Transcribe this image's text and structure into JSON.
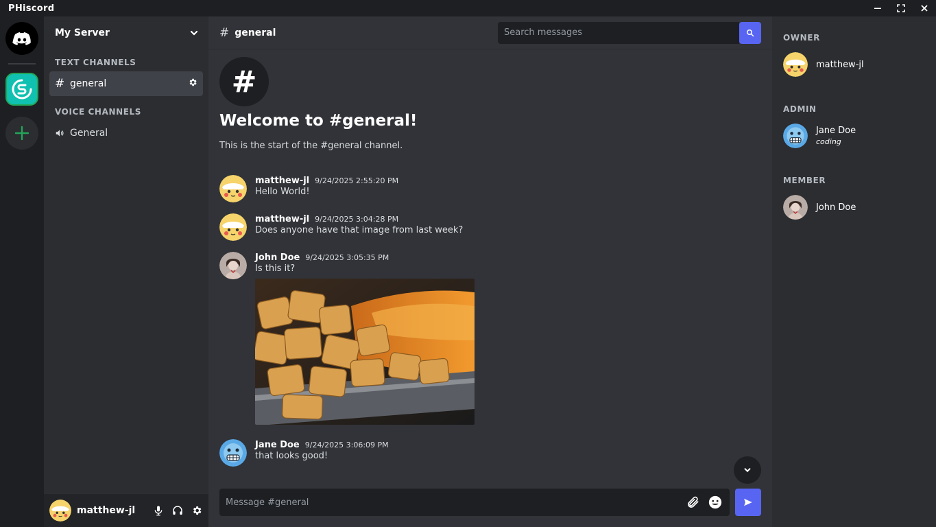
{
  "window": {
    "title": "PHiscord",
    "controls": [
      "minimize-icon",
      "maximize-icon",
      "close-icon"
    ]
  },
  "rail": {
    "items": [
      {
        "name": "home",
        "icon": "discord-logo-icon"
      },
      {
        "name": "server",
        "icon": "server-logo-icon"
      },
      {
        "name": "add-server",
        "icon": "plus-icon"
      }
    ]
  },
  "server": {
    "name": "My Server",
    "text_category": "TEXT CHANNELS",
    "voice_category": "VOICE CHANNELS",
    "text_channels": [
      {
        "name": "general",
        "active": true
      }
    ],
    "voice_channels": [
      {
        "name": "General"
      }
    ]
  },
  "current_user": {
    "name": "matthew-jl"
  },
  "channel": {
    "name": "general",
    "welcome_title": "Welcome to #general!",
    "welcome_sub": "This is the start of the #general channel.",
    "search_placeholder": "Search messages",
    "composer_placeholder": "Message #general"
  },
  "messages": [
    {
      "author": "matthew-jl",
      "timestamp": "9/24/2025 2:55:20 PM",
      "text": "Hello World!",
      "avatar": "pikachu"
    },
    {
      "author": "matthew-jl",
      "timestamp": "9/24/2025 3:04:28 PM",
      "text": "Does anyone have that image from last week?",
      "avatar": "pikachu"
    },
    {
      "author": "John Doe",
      "timestamp": "9/24/2025 3:05:35 PM",
      "text": "Is this it?",
      "avatar": "photo",
      "has_image": true
    },
    {
      "author": "Jane Doe",
      "timestamp": "9/24/2025 3:06:09 PM",
      "text": "that looks good!",
      "avatar": "emoji"
    }
  ],
  "members": {
    "roles": [
      {
        "title": "OWNER",
        "users": [
          {
            "name": "matthew-jl",
            "status": ""
          }
        ]
      },
      {
        "title": "ADMIN",
        "users": [
          {
            "name": "Jane Doe",
            "status": "coding"
          }
        ]
      },
      {
        "title": "MEMBER",
        "users": [
          {
            "name": "John Doe",
            "status": ""
          }
        ]
      }
    ]
  },
  "colors": {
    "accent": "#5865f2",
    "online": "#23a559",
    "server": "#10c0b0"
  }
}
